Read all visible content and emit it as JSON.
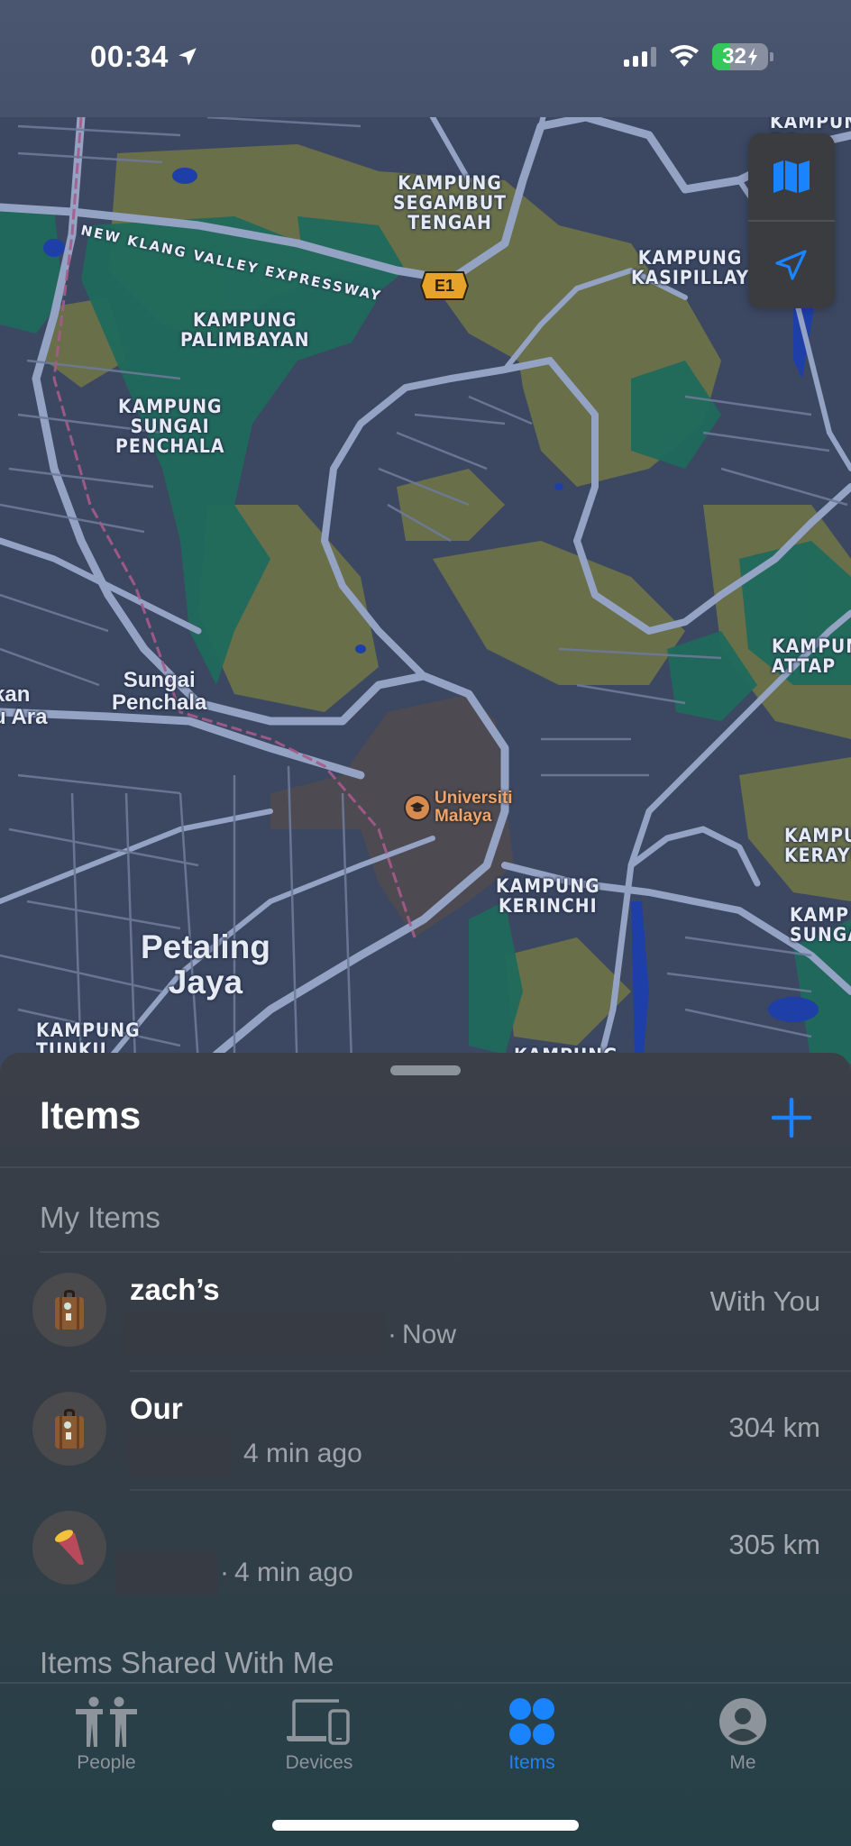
{
  "status_bar": {
    "time": "00:34",
    "location_active": true,
    "signal_bars_active": 3,
    "signal_bars_total": 4,
    "wifi": true,
    "battery_percent": 32,
    "battery_label": "32",
    "charging": true
  },
  "map": {
    "labels": {
      "kampung_segambut_tengah": "KAMPUNG\nSEGAMBUT\nTENGAH",
      "kampung_kasipillay": "KAMPUNG\nKASIPILLAY",
      "kampung_palimbayan": "KAMPUNG\nPALIMBAYAN",
      "kampung_sungai_penchala": "KAMPUNG\nSUNGAI\nPENCHALA",
      "sungai_penchala": "Sungai\nPenchala",
      "kan_u_ara": "kan\nu Ara",
      "petaling_jaya": "Petaling\nJaya",
      "kampung_kerinchi": "KAMPUNG\nKERINCHI",
      "kampung_attap": "KAMPUN\nATTAP",
      "kampung_kerayu": "KAMPU\nKERAYU",
      "kampung_sunga": "KAMP\nSUNGA",
      "kampung_tunku": "KAMPUNG\nTUNKU",
      "kampung_top_right": "KAMPUN\nDA\nA",
      "kampung_bottom": "KAMPUNG"
    },
    "road_label": "NEW KLANG VALLEY EXPRESSWAY",
    "highway_shield": "E1",
    "poi": {
      "name": "Universiti\nMalaya",
      "icon": "graduation-cap-icon",
      "color": "#f0a46a"
    },
    "controls": {
      "map_mode_icon": "map-icon",
      "locate_icon": "location-arrow-icon",
      "accent": "#1a84ff"
    }
  },
  "sheet": {
    "title": "Items",
    "add_icon": "plus-icon",
    "sections": [
      {
        "header": "My Items",
        "items": [
          {
            "name": "zach’s",
            "icon": "suitcase-emoji",
            "emoji": "🧳",
            "location_redacted": true,
            "separator": "·",
            "time": "Now",
            "distance": "With You"
          },
          {
            "name": "Our",
            "icon": "suitcase-emoji",
            "emoji": "🧳",
            "location_redacted": true,
            "separator": "",
            "time": "4 min ago",
            "distance": "304 km"
          },
          {
            "name": "",
            "icon": "sweet-potato-emoji",
            "emoji": "🍠",
            "location_redacted": true,
            "separator": "·",
            "time": "4 min ago",
            "distance": "305 km"
          }
        ]
      },
      {
        "header": "Items Shared With Me",
        "items": []
      }
    ]
  },
  "tab_bar": {
    "tabs": [
      {
        "label": "People",
        "icon": "people-icon",
        "active": false
      },
      {
        "label": "Devices",
        "icon": "devices-icon",
        "active": false
      },
      {
        "label": "Items",
        "icon": "items-icon",
        "active": true
      },
      {
        "label": "Me",
        "icon": "me-icon",
        "active": false
      }
    ],
    "active_color": "#1a84ff",
    "inactive_color": "#8d949b"
  }
}
